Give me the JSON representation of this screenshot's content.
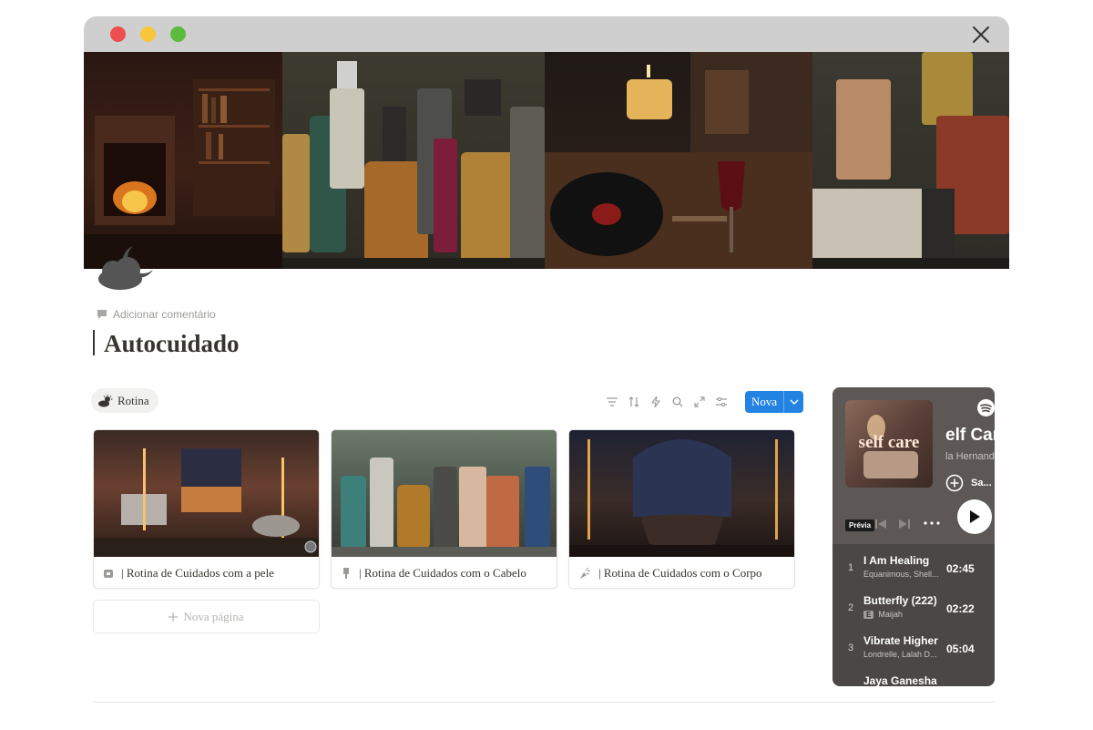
{
  "window": {
    "close_icon": "close-icon",
    "traffic_lights": [
      "#ee4e4e",
      "#f7c63b",
      "#5cbb3d"
    ]
  },
  "page": {
    "icon": "cloud-moon-icon",
    "add_comment": "Adicionar comentário",
    "title": "Autocuidado"
  },
  "database": {
    "view_tab": "Rotina",
    "view_icon": "sun-cloud-icon",
    "toolbar": {
      "icons": [
        "filter-icon",
        "sort-icon",
        "lightning-icon",
        "search-icon",
        "expand-icon",
        "settings-icon"
      ],
      "new_label": "Nova"
    },
    "cards": [
      {
        "label": "| Rotina de Cuidados com a pele",
        "icon": "skincare-icon"
      },
      {
        "label": "| Rotina de Cuidados com o Cabelo",
        "icon": "hairbrush-icon"
      },
      {
        "label": "| Rotina de Cuidados com o Corpo",
        "icon": "spray-icon"
      }
    ],
    "new_page": "Nova página"
  },
  "spotify": {
    "art_text": "self care",
    "title": "elf Car",
    "artist": "la Hernand",
    "save_label": "Sa...",
    "preview_label": "Prévia",
    "tracks": [
      {
        "num": "1",
        "name": "I Am Healing",
        "artist": "Equanimous, Shell...",
        "duration": "02:45",
        "explicit": false
      },
      {
        "num": "2",
        "name": "Butterfly (222)",
        "artist": "Maijah",
        "duration": "02:22",
        "explicit": true,
        "badge": "E"
      },
      {
        "num": "3",
        "name": "Vibrate Higher",
        "artist": "Londrelle, Lalah D...",
        "duration": "05:04",
        "explicit": false
      },
      {
        "num": "",
        "name": "Jaya Ganesha",
        "artist": "",
        "duration": "",
        "explicit": false
      }
    ]
  },
  "colors": {
    "accent": "#2383e2",
    "spotify_bg": "#4a4746",
    "text": "#37352f",
    "muted": "#9b9a97"
  }
}
